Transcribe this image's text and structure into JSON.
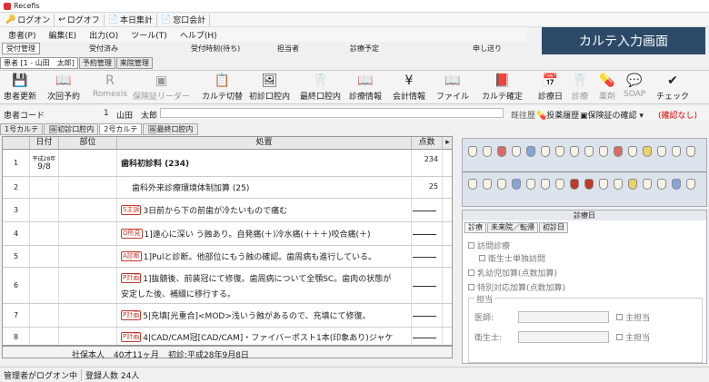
{
  "app_title": "Recefis",
  "quickbar": {
    "logon": "ログオン",
    "logoff": "ログオフ",
    "daily": "本日集計",
    "counter": "窓口会計"
  },
  "menu": [
    "患者(P)",
    "編集(E)",
    "出力(O)",
    "ツール(T)",
    "ヘルプ(H)"
  ],
  "badge": "カルテ入力画面",
  "reception": {
    "tab": "受付管理",
    "cols": [
      "受付済み",
      "受付時刻(待ち)",
      "担当者",
      "診療予定",
      "申し送り"
    ]
  },
  "patient_tabs": [
    "患者 [1 - 山田　太郎]",
    "予約管理",
    "来院管理"
  ],
  "toolbar": [
    {
      "label": "患者更新",
      "icon": "save-icon",
      "glyph": "💾",
      "en": true
    },
    {
      "label": "次回予約",
      "icon": "book-icon",
      "glyph": "📖",
      "en": true
    },
    {
      "label": "Romexis",
      "icon": "romexis-icon",
      "glyph": "R",
      "en": false
    },
    {
      "label": "保険証リーダー",
      "icon": "card-reader-icon",
      "glyph": "▣",
      "en": false
    },
    {
      "label": "カルテ切替",
      "icon": "chart-switch-icon",
      "glyph": "📋",
      "en": true
    },
    {
      "label": "初診口腔内",
      "icon": "first-oral-icon",
      "glyph": "🖼",
      "en": true
    },
    {
      "label": "最終口腔内",
      "icon": "last-oral-icon",
      "glyph": "🦷",
      "en": true
    },
    {
      "label": "診療情報",
      "icon": "clinical-info-icon",
      "glyph": "📖",
      "en": true
    },
    {
      "label": "会計情報",
      "icon": "accounting-icon",
      "glyph": "¥",
      "en": true
    },
    {
      "label": "ファイル",
      "icon": "file-icon",
      "glyph": "📖",
      "en": true
    },
    {
      "label": "カルテ確定",
      "icon": "chart-confirm-icon",
      "glyph": "📕",
      "en": true
    },
    {
      "label": "診療日",
      "icon": "calendar-icon",
      "glyph": "📅",
      "en": true
    },
    {
      "label": "診療",
      "icon": "tooth-icon",
      "glyph": "🦷",
      "en": false
    },
    {
      "label": "薬剤",
      "icon": "pill-icon",
      "glyph": "💊",
      "en": false
    },
    {
      "label": "SOAP",
      "icon": "soap-icon",
      "glyph": "💬",
      "en": false
    },
    {
      "label": "チェック",
      "icon": "check-icon",
      "glyph": "✔",
      "en": true
    }
  ],
  "patient_info": {
    "code_label": "患者コード",
    "code": "1",
    "name": "山田　太郎",
    "history": "既往歴",
    "drug_history": "投薬履歴",
    "insurance_check": "保険証の確認",
    "unconfirmed": "(確認なし)"
  },
  "subtabs": [
    "1号カルテ",
    "初診口腔内",
    "2号カルテ",
    "最終口腔内"
  ],
  "grid": {
    "headers": [
      "日付",
      "部位",
      "処置",
      "点数"
    ],
    "date_era": "平成28年",
    "date_day": "9/8",
    "rows": [
      {
        "n": "1",
        "tag": "",
        "text": "歯科初診料 (234)",
        "pts": "234",
        "bold": true
      },
      {
        "n": "2",
        "tag": "",
        "text": "歯科外来診療環境体制加算 (25)",
        "pts": "25",
        "bold": false
      },
      {
        "n": "3",
        "tag": "S主訴",
        "text": "3日前から下の前歯が冷たいもので痛む",
        "pts": "",
        "bold": false
      },
      {
        "n": "4",
        "tag": "O所見",
        "text": "1]遠心に深い う蝕あり。自発痛(＋)冷水痛(＋＋＋)咬合痛(＋)",
        "pts": "",
        "bold": false
      },
      {
        "n": "5",
        "tag": "A診断",
        "text": "1]Pulと診断。他部位にもう蝕の確認。歯周病も進行している。",
        "pts": "",
        "bold": false
      },
      {
        "n": "6",
        "tag": "P計画",
        "text": "1]抜髄後、前装冠にて修復。歯周病について全顎SC。歯肉の状態が",
        "text2": "安定した後、補綴に移行する。",
        "pts": "",
        "bold": false
      },
      {
        "n": "7",
        "tag": "P計画",
        "text": "5|充填[光重合]<MOD>浅いう蝕があるので、充填にて修復。",
        "pts": "",
        "bold": false
      },
      {
        "n": "8",
        "tag": "P計画",
        "text": "4|CAD/CAM冠[CAD/CAM]・ファイバーポスト1本(印象あり)ジャケ",
        "pts": "",
        "bold": false
      }
    ],
    "footer": {
      "insurance": "社保本人",
      "age": "40才11ヶ月",
      "first_visit": "初診:平成28年9月8日"
    }
  },
  "right_panel": {
    "title": "診療日",
    "tabs": [
      "診療",
      "未来院／転帰",
      "初診日"
    ],
    "items": [
      "訪問診療",
      "衛生士単独訪問",
      "乳幼児加算(点数加算)",
      "特別対応加算(点数加算)"
    ],
    "group": "担当",
    "doctor_label": "医師:",
    "hygienist_label": "衛生士:",
    "main_label": "主担当"
  },
  "status": {
    "logon": "管理者がログオン中",
    "count": "登録人数 24人"
  }
}
